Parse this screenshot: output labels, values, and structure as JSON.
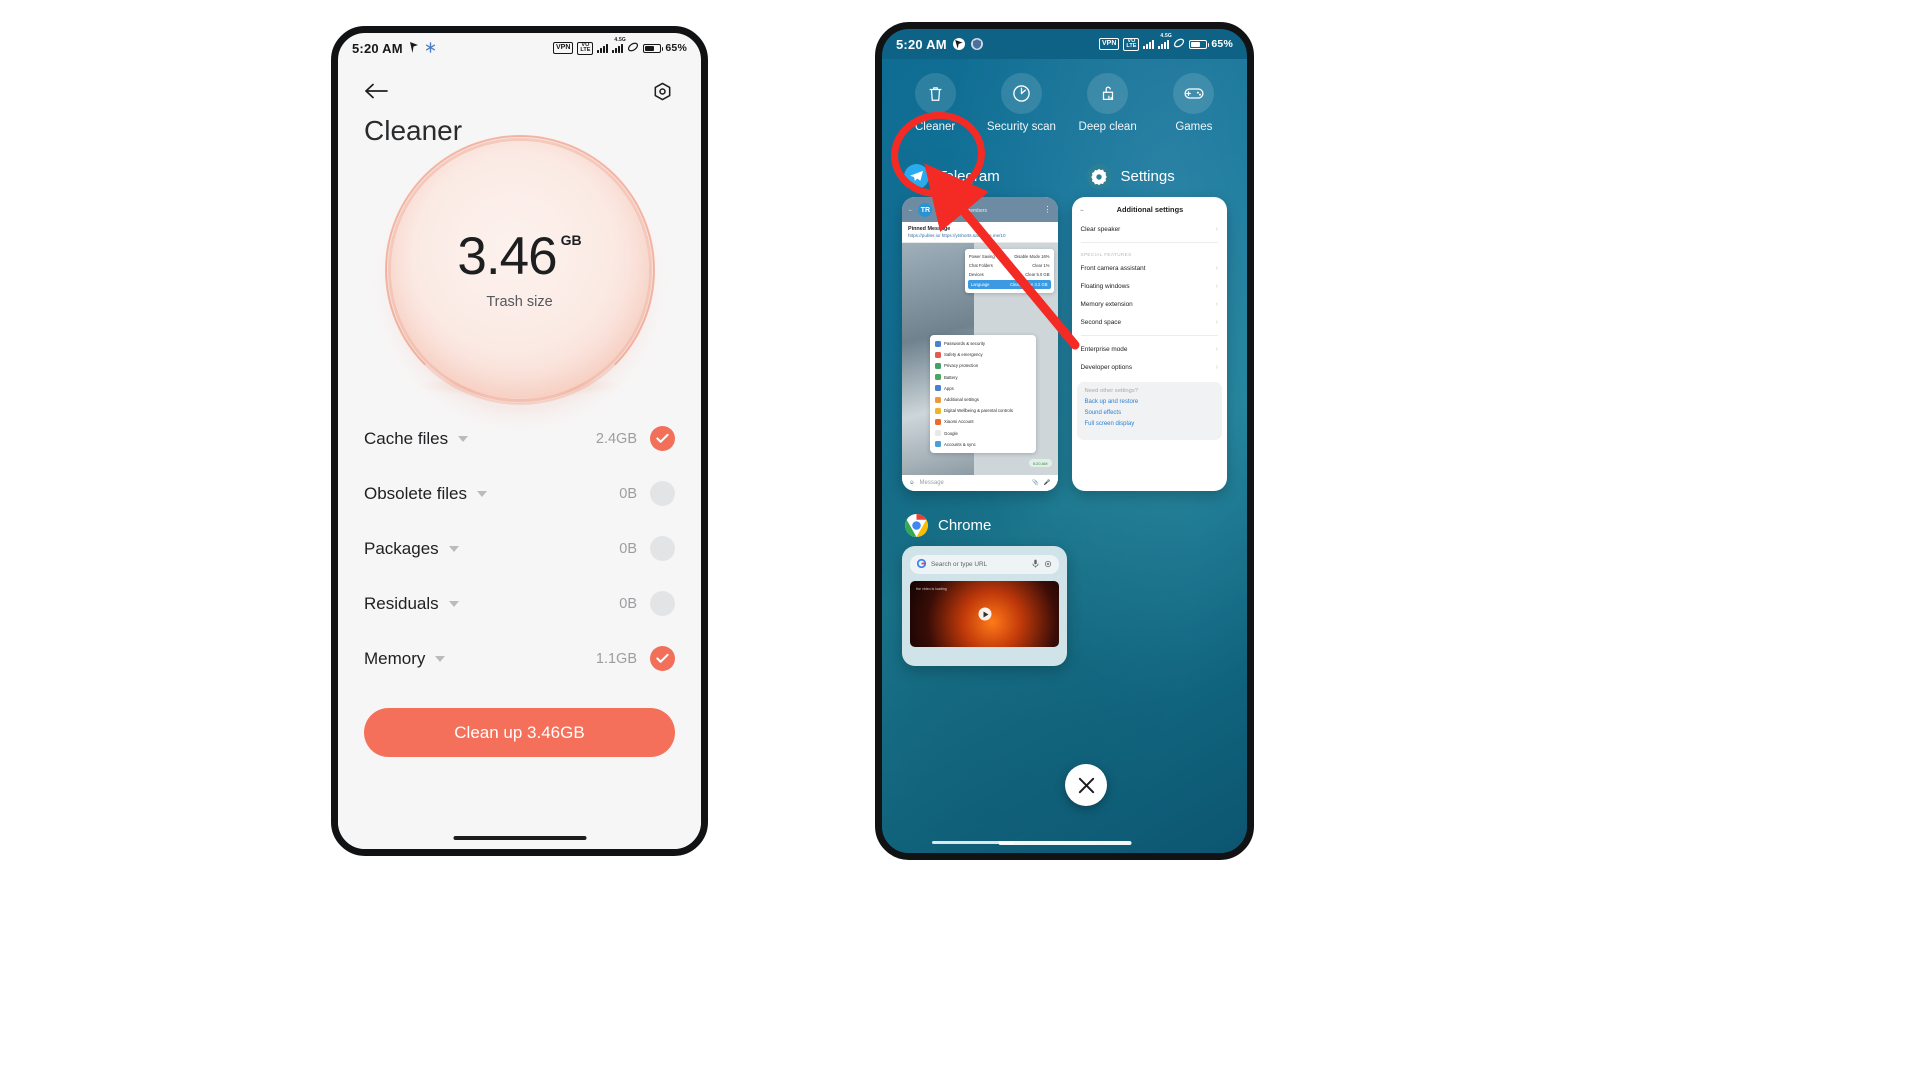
{
  "left_phone": {
    "status_bar": {
      "time": "5:20 AM",
      "battery_percent": "65%",
      "icons": [
        "location-icon",
        "snowflake-icon",
        "vpn-icon",
        "volte-icon",
        "signal-bars-icon",
        "signal-bars-4g-icon",
        "4.5G",
        "sync-icon",
        "battery-icon"
      ]
    },
    "app": {
      "title": "Cleaner",
      "back_label": "Back",
      "settings_label": "Settings"
    },
    "gauge": {
      "value": "3.46",
      "unit": "GB",
      "caption": "Trash size"
    },
    "list": [
      {
        "name": "Cache files",
        "size": "2.4GB",
        "checked": true
      },
      {
        "name": "Obsolete files",
        "size": "0B",
        "checked": false
      },
      {
        "name": "Packages",
        "size": "0B",
        "checked": false
      },
      {
        "name": "Residuals",
        "size": "0B",
        "checked": false
      },
      {
        "name": "Memory",
        "size": "1.1GB",
        "checked": true
      }
    ],
    "cta": "Clean up 3.46GB",
    "accent_color": "#f4705a",
    "inactive_color": "#e3e4e5"
  },
  "right_phone": {
    "status_bar": {
      "time": "5:20 AM",
      "battery_percent": "65%",
      "icons": [
        "location-badge-icon",
        "shield-icon",
        "vpn-icon",
        "volte-icon",
        "signal-bars-icon",
        "signal-bars-4g-icon",
        "4.5G",
        "sync-icon",
        "battery-icon"
      ]
    },
    "quick_actions": [
      {
        "label": "Cleaner",
        "icon": "trash-icon",
        "highlighted": true
      },
      {
        "label": "Security\nscan",
        "icon": "speedometer-icon",
        "highlighted": false
      },
      {
        "label": "Deep clean",
        "icon": "brush-icon",
        "highlighted": false
      },
      {
        "label": "Games",
        "icon": "gamepad-icon",
        "highlighted": false
      }
    ],
    "recent_apps": [
      {
        "name": "Telegram",
        "icon": "telegram-icon"
      },
      {
        "name": "Settings",
        "icon": "gear-icon"
      },
      {
        "name": "Chrome",
        "icon": "chrome-icon"
      }
    ],
    "telegram_card": {
      "chat_title": "TR Plus",
      "chat_members": "2 members",
      "pinned_label": "Pinned Message",
      "pinned_url": "https://publer.io/  https://ytshorts.savetube.me/10",
      "sheet_rows": [
        {
          "left": "Power Saving",
          "right": "Disable Mode  16%"
        },
        {
          "left": "Chat Folders",
          "right": "Clear  1%"
        },
        {
          "left": "Devices",
          "right": "Clear  5.0 GB"
        },
        {
          "left": "Language",
          "right": "Clear Cache  3.2 GB"
        }
      ],
      "settings_rows": [
        "Passwords & security",
        "Safety & emergency",
        "Privacy protection",
        "Battery",
        "Apps",
        "Additional settings",
        "Digital Wellbeing & parental controls",
        "Xiaomi Account",
        "Google",
        "Accounts & sync"
      ],
      "input_placeholder": "Message",
      "timestamp": "5:20 AM"
    },
    "settings_card": {
      "header": "Additional settings",
      "items_top": [
        "Clear speaker"
      ],
      "section_caption": "SPECIAL FEATURES",
      "items_features": [
        "Front camera assistant",
        "Floating windows",
        "Memory extension",
        "Second space"
      ],
      "items_bottom": [
        "Enterprise mode",
        "Developer options"
      ],
      "footer_question": "Need other settings?",
      "footer_links": [
        "Back up and restore",
        "Sound effects",
        "Full screen display"
      ]
    },
    "chrome_card": {
      "omnibox_placeholder": "Search or type URL",
      "hero_caption": "the video is loading"
    },
    "close_label": "Close all",
    "annotation_color": "#f42b24"
  }
}
